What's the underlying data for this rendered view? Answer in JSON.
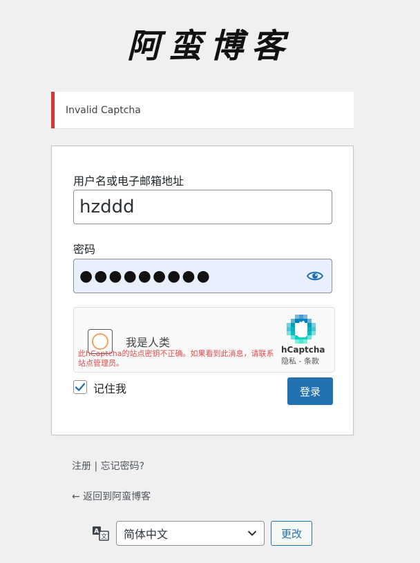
{
  "site": {
    "logo_text": "阿蛮博客"
  },
  "notice": {
    "message": "Invalid Captcha"
  },
  "form": {
    "username_label": "用户名或电子邮箱地址",
    "username_value": "hzddd",
    "password_label": "密码",
    "password_value": "●●●●●●●●●",
    "remember_label": "记住我",
    "remember_checked": true,
    "submit_label": "登录"
  },
  "captcha": {
    "checkbox_label": "我是人类",
    "error": "此hCaptcha的站点密钥不正确。如果看到此消息，请联系站点管理员。",
    "brand": "hCaptcha",
    "links": "隐私 - 条款"
  },
  "footer": {
    "register": "注册",
    "separator": " | ",
    "lost_password": "忘记密码?",
    "back_link": "← 返回到阿蛮博客"
  },
  "language": {
    "selected": "简体中文",
    "change_button": "更改"
  },
  "colors": {
    "primary": "#2271b1",
    "error": "#d63638",
    "autofill_bg": "#e8f0fe"
  }
}
